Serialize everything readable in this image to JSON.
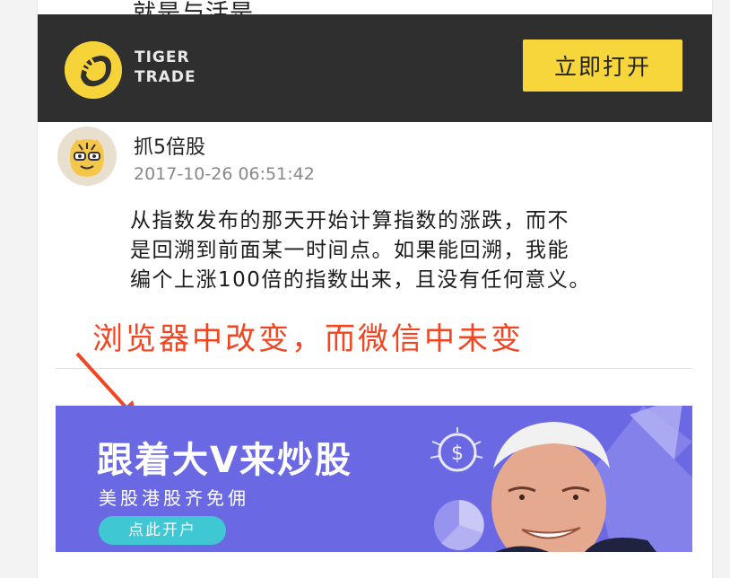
{
  "overlay_top_text": "就是与活是。",
  "header": {
    "logo_line1": "TIGER",
    "logo_line2": "TRADE",
    "open_button": "立即打开"
  },
  "post": {
    "username": "抓5倍股",
    "timestamp": "2017-10-26 06:51:42",
    "comment_lines": [
      "从指数发布的那天开始计算指数的涨跌，而不",
      "是回溯到前面某一时间点。如果能回溯，我能",
      "编个上涨100倍的指数出来，且没有任何意义。"
    ]
  },
  "annotation": "浏览器中改变，而微信中未变",
  "banner": {
    "title": "跟着大V来炒股",
    "subtitle": "美股港股齐免佣",
    "button": "点此开户"
  },
  "colors": {
    "header_bg": "#2f2f2f",
    "accent_yellow": "#f7d63b",
    "annotation_red": "#f24522",
    "banner_bg": "#6a68e3",
    "banner_button": "#3fc7d3"
  }
}
